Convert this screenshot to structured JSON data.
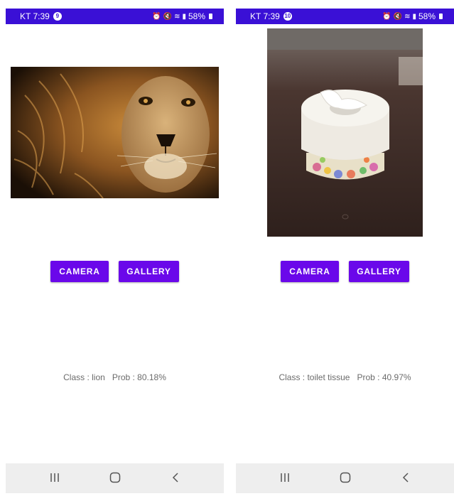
{
  "screens": [
    {
      "status_bar": {
        "carrier_time": "KT 7:39",
        "notification_count": "9",
        "battery": "58%"
      },
      "photo": {
        "subject": "lion"
      },
      "buttons": {
        "camera": "CAMERA",
        "gallery": "GALLERY"
      },
      "result": {
        "class_text": "Class : lion",
        "prob_text": "Prob : 80.18%"
      }
    },
    {
      "status_bar": {
        "carrier_time": "KT 7:39",
        "notification_count": "10",
        "battery": "58%"
      },
      "photo": {
        "subject": "toilet tissue"
      },
      "buttons": {
        "camera": "CAMERA",
        "gallery": "GALLERY"
      },
      "result": {
        "class_text": "Class : toilet tissue",
        "prob_text": "Prob : 40.97%"
      }
    }
  ],
  "colors": {
    "status_bar": "#3a10d6",
    "button": "#6a08ea",
    "nav_bar": "#eeeeee",
    "result_text": "#6b6b6b"
  },
  "icons": [
    "alarm-icon",
    "mute-icon",
    "wifi-icon",
    "signal-icon",
    "battery-icon",
    "recents-icon",
    "home-icon",
    "back-icon"
  ]
}
